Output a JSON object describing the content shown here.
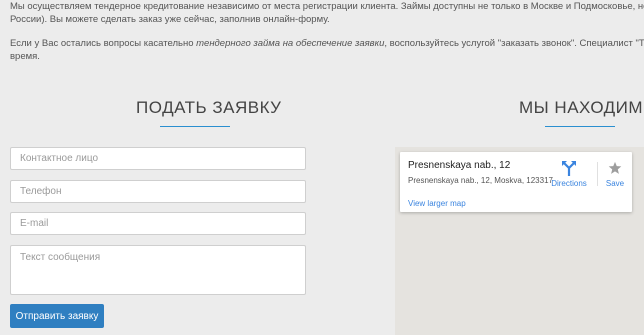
{
  "intro": {
    "line1": "Мы осуществляем тендерное кредитование независимо от места регистрации клиента. Займы доступны не только в Москве и Подмосковье, но и в других го",
    "line2": "России). Вы можете сделать заказ уже сейчас, заполнив онлайн-форму.",
    "line3_pre": "Если у Вас остались вопросы касательно ",
    "line3_em": "тендерного займа на обеспечение заявки",
    "line3_post": ", воспользуйтесь услугой \"заказать звонок\". Специалист \"ТаймКредит\" св",
    "line4": "время."
  },
  "form": {
    "title": "ПОДАТЬ ЗАЯВКУ",
    "contact_placeholder": "Контактное лицо",
    "phone_placeholder": "Телефон",
    "email_placeholder": "E-mail",
    "message_placeholder": "Текст сообщения",
    "submit_label": "Отправить заявку"
  },
  "location": {
    "title": "МЫ НАХОДИМСЯ",
    "place_title": "Presnenskaya nab., 12",
    "place_address": "Presnenskaya nab., 12, Moskva, 123317",
    "directions_label": "Directions",
    "save_label": "Save",
    "view_larger_label": "View larger map"
  },
  "colors": {
    "accent": "#2a8fd0",
    "button": "#2f7fc1",
    "link": "#3a84df",
    "map_bg": "#e5e3df"
  },
  "icons": {
    "directions": "directions-icon",
    "save": "star-icon"
  }
}
